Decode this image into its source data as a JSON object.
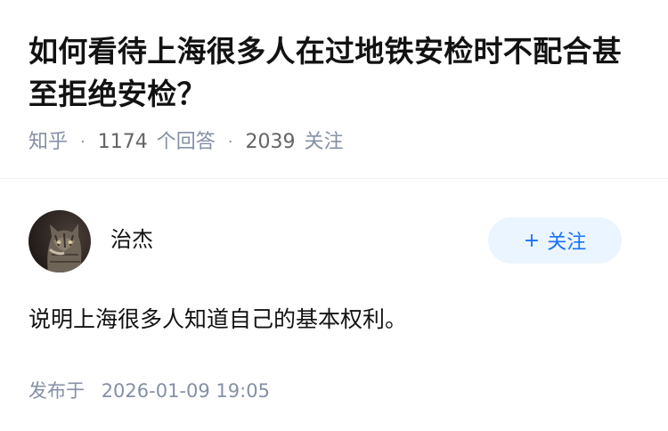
{
  "question": {
    "title": "如何看待上海很多人在过地铁安检时不配合甚至拒绝安检？",
    "source": "知乎",
    "answers_count": "1174",
    "answers_label": "个回答",
    "followers_count": "2039",
    "followers_label": "关注"
  },
  "answer": {
    "author_name": "治杰",
    "follow_label": "关注",
    "follow_icon": "plus-icon",
    "content": "说明上海很多人知道自己的基本权利。",
    "publish_label": "发布于",
    "publish_time": "2026-01-09 19:05"
  },
  "colors": {
    "title": "#121212",
    "meta": "#8590a6",
    "accent": "#1772f6",
    "follow_bg": "#ebf5ff"
  }
}
